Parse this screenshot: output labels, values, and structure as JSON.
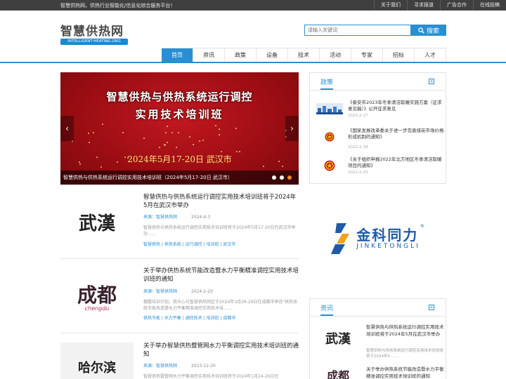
{
  "topbar": {
    "slogan": "智慧供热网，供热行业智能化/信息化综合服务平台！",
    "links": [
      "关于我们",
      "寻求报道",
      "广告合作",
      "在线投稿"
    ]
  },
  "logo": {
    "cn": "智慧供热网",
    "en": "INTELLIGENT-HEATING.ORG"
  },
  "search": {
    "placeholder": "请输入关键词",
    "button": "搜索"
  },
  "nav": [
    {
      "label": "首页",
      "active": true
    },
    {
      "label": "资讯"
    },
    {
      "label": "政策"
    },
    {
      "label": "设备"
    },
    {
      "label": "技术"
    },
    {
      "label": "活动"
    },
    {
      "label": "专家"
    },
    {
      "label": "招标"
    },
    {
      "label": "人才"
    }
  ],
  "slider": {
    "line1": "智慧供热与供热系统运行调控",
    "line2": "实用技术培训班",
    "date": "2024年5月17-20日  武汉市",
    "caption": "智慧供热与供热系统运行调控实用技术培训班（2024年5月17-20日 武汉市）",
    "prev": "‹",
    "next": "›",
    "active_dot": 2
  },
  "articles": [
    {
      "thumb_text": "武漢",
      "title": "智慧供热与供热系统运行调控实用技术培训班将于2024年5月在武汉市举办",
      "source_label": "来源：",
      "source": "智慧供热网",
      "date": "2024-4-3",
      "desc": "智慧供热与供热系统运行调控实用技术培训班将于2024年5月17-20日在武汉市举办……",
      "tags": "智慧供热 | 供热系统 | 运行调控 | 培训班 | 武汉市"
    },
    {
      "thumb_text": "成都",
      "thumb_sub": "chengdu",
      "title": "关于举办供热系统节能改造暨水力平衡精准调控实用技术培训班的通知",
      "source_label": "来源：",
      "source": "智慧供热网",
      "date": "2024-2-20",
      "desc": "棚履培训计划，我中心与智慧供热网定于2024年3月26-29日在成都市举办\"供热系统节能改造暨水力平衡精准调控实用技术培……",
      "tags": "供热节能 | 水力平衡 | 调控技术 | 培训班 | 成都市"
    },
    {
      "thumb_text": "哈尔滨",
      "title": "关于举办智慧供热暨管网水力平衡调控实用技术培训班的通知",
      "source_label": "来源：",
      "source": "智慧供热网",
      "date": "2023-12-20",
      "desc": "智慧供热暨管网水力平衡调控实用技术培训班将于2024年1月24-26日在"
    }
  ],
  "policy": {
    "title": "政策",
    "plus": "+",
    "items": [
      {
        "text": "《泰安市2023年冬季清洁取暖实施方案（征求意见稿）》公开征求意见",
        "date": "2023-2-27"
      },
      {
        "text": "《国家发展改革委关于进一步完善煤炭市场价格形成机制的通知》",
        "date": "2022-2-28"
      },
      {
        "text": "《关于组织申报2022年北方地区冬季清洁取暖项目的通知》",
        "date": "2022-2-25"
      }
    ]
  },
  "ad": {
    "zh": "金科同力",
    "en": "JINKETONGLI",
    "reg": "®"
  },
  "news": {
    "title": "资讯",
    "plus": "+",
    "items": [
      {
        "thumb_text": "武漢",
        "text": "智慧供热与供热系统运行调控实用技术培训班将于2024年5月在武汉市举办",
        "desc": "智慧供热与供热系统运行调控实用技术培训班将于2024年5……"
      },
      {
        "thumb_text": "成都",
        "text": "关于举办供热系统节能改造暨水力平衡精准调控实用技术培训班的通知",
        "desc": ""
      }
    ]
  },
  "colors": {
    "accent": "#2a8fd2",
    "slider_red": "#9f0e14",
    "dot_active": "#f28b1a"
  }
}
